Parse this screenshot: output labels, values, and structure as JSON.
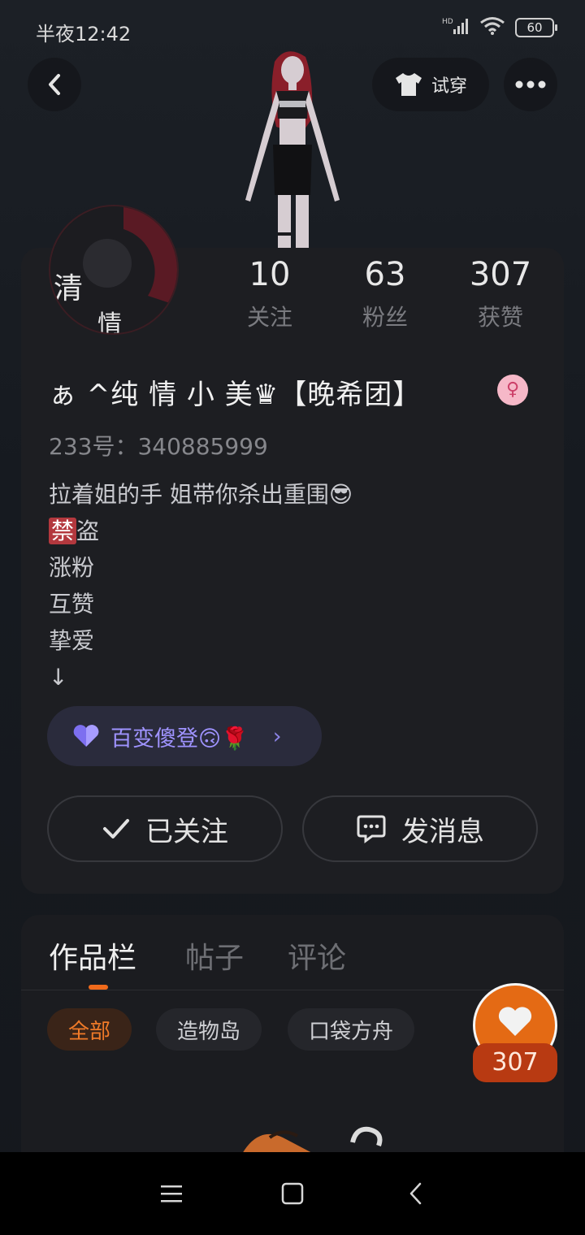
{
  "status_bar": {
    "time": "半夜12:42",
    "battery": "60",
    "network_label": "HD"
  },
  "header": {
    "try_on_label": "试穿"
  },
  "avatar": {
    "overlay_text_1": "清",
    "overlay_text_2": "情"
  },
  "stats": [
    {
      "value": "10",
      "label": "关注"
    },
    {
      "value": "63",
      "label": "粉丝"
    },
    {
      "value": "307",
      "label": "获赞"
    }
  ],
  "profile": {
    "username": "ぁ ^纯 情 小 美♛【晚希团】",
    "gender_symbol": "♀",
    "uid": "233号：340885999",
    "bio_line_1": "拉着姐的手 姐带你杀出重围😎",
    "bio_ban": "禁",
    "bio_line_2_rest": "盗",
    "bio_line_3": "涨粉",
    "bio_line_4": "互赞",
    "bio_line_5": "挚爱",
    "bio_line_6": "↓"
  },
  "group_chip": {
    "label": "百变傻登🙃🌹",
    "icon": "heart-icon",
    "arrow": "›"
  },
  "actions": {
    "followed_label": "已关注",
    "message_label": "发消息"
  },
  "tabs": [
    {
      "label": "作品栏",
      "active": true
    },
    {
      "label": "帖子",
      "active": false
    },
    {
      "label": "评论",
      "active": false
    }
  ],
  "filters": [
    {
      "label": "全部",
      "active": true
    },
    {
      "label": "造物岛",
      "active": false
    },
    {
      "label": "口袋方舟",
      "active": false
    }
  ],
  "like_fab": {
    "count": "307"
  },
  "colors": {
    "accent": "#f06a1b",
    "chip_text": "#9f93ff",
    "fab": "#e46a14"
  }
}
